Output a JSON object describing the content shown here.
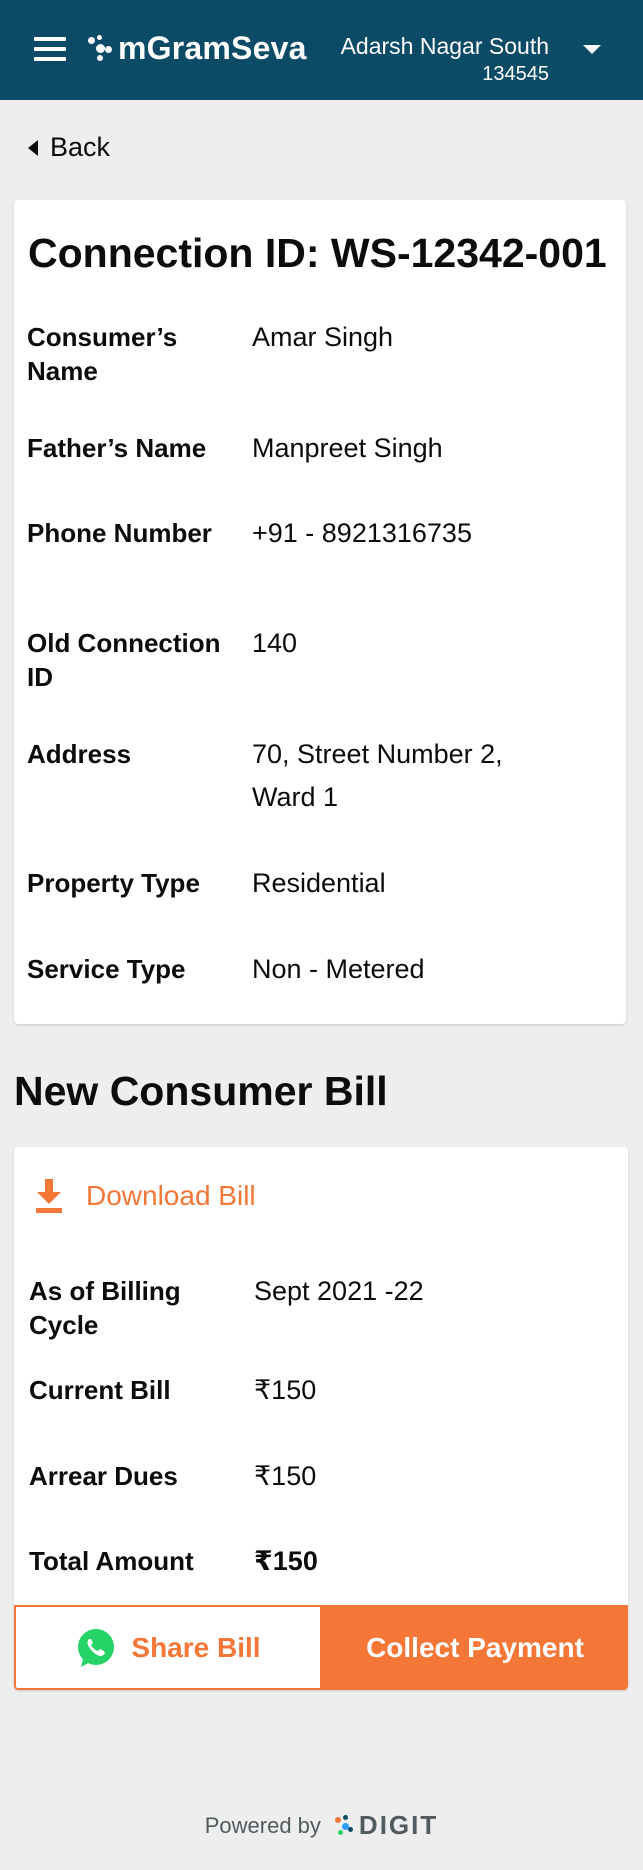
{
  "header": {
    "app_name": "mGramSeva",
    "tenant_name": "Adarsh Nagar South",
    "tenant_code": "134545"
  },
  "back_label": "Back",
  "connection": {
    "title": "Connection ID: WS-12342-001",
    "fields": [
      {
        "label": "Consumer’s Name",
        "value": "Amar Singh"
      },
      {
        "label": "Father’s Name",
        "value": "Manpreet Singh"
      },
      {
        "label": "Phone Number",
        "value": "+91 - 8921316735"
      },
      {
        "label": "Old Connection ID",
        "value": "140"
      },
      {
        "label": "Address",
        "value": "70, Street Number 2, Ward 1"
      },
      {
        "label": "Property Type",
        "value": "Residential"
      },
      {
        "label": "Service Type",
        "value": "Non - Metered"
      }
    ]
  },
  "bill": {
    "section_title": "New Consumer Bill",
    "download_label": "Download Bill",
    "fields": [
      {
        "label": "As of Billing Cycle",
        "value": "Sept 2021 -22"
      },
      {
        "label": "Current Bill",
        "value": "₹150"
      },
      {
        "label": "Arrear Dues",
        "value": "₹150"
      },
      {
        "label": "Total Amount",
        "value": "₹150"
      }
    ],
    "share_label": "Share Bill",
    "collect_label": "Collect Payment"
  },
  "footer": {
    "powered_by": "Powered by",
    "brand": "DIGIT"
  },
  "colors": {
    "header_bg": "#0b4b66",
    "accent": "#f47738",
    "whatsapp": "#25d366"
  },
  "icons": {
    "menu": "hamburger-icon",
    "dropdown": "caret-down-icon",
    "back": "caret-left-icon",
    "download": "download-icon",
    "share": "whatsapp-icon"
  }
}
